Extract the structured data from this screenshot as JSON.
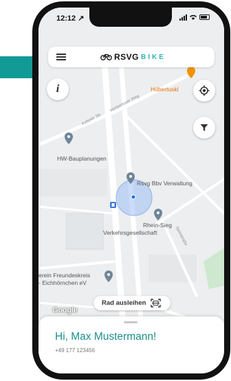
{
  "status_bar": {
    "time": "12:12 ↗"
  },
  "header": {
    "logo_brand": "RSVG",
    "logo_sub": "BIKE",
    "menu_icon": "hamburger-menu-icon"
  },
  "map": {
    "pois": {
      "huebertuskl": "Hübertuskl",
      "hw_bauplanungen": "HW-Bauplanungen",
      "rsvg_verwaltung": "Rsvg Bbv Verwaltung",
      "rhein_sieg_line1": "Rhein-Sieg",
      "rhein_sieg_line2": "Verkehrsgesellschaft",
      "verein_line1": "erein Freundeskreis",
      "verein_line2": "- Eichhörnchen eV"
    },
    "streets": {
      "hubertusweg": "Hünbertuser Weg",
      "ketteler": "Ketteler Str.",
      "steinstrasse": "Steinstraße"
    },
    "attribution": "Google",
    "user_location_color": "#3b82f6",
    "pin_color": "#6f8596",
    "road_color": "#ffffff"
  },
  "controls": {
    "info_icon_glyph": "i",
    "locate_icon": "crosshair-locate-icon",
    "filter_icon": "filter-funnel-icon",
    "rent_button_label": "Rad ausleihen",
    "rent_icon": "qr-scan-icon"
  },
  "sheet": {
    "greeting": "Hi, Max Mustermann!",
    "phone": "+49 177 123456"
  },
  "colors": {
    "accent": "#1a8f8a",
    "logo_teal": "#2fb6b0",
    "annotation_arrow": "#129a96"
  }
}
